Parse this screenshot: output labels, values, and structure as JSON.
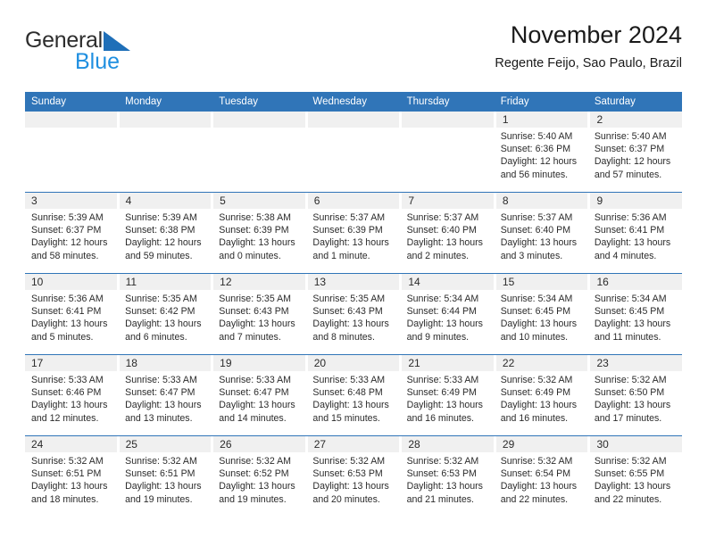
{
  "brand": {
    "word_general": "General",
    "word_blue": "Blue",
    "triangle_color": "#1f6fb8",
    "blue_text_color": "#1f8fe0"
  },
  "header": {
    "title": "November 2024",
    "subtitle": "Regente Feijo, Sao Paulo, Brazil"
  },
  "colors": {
    "header_blue": "#3075b8",
    "day_band_gray": "#f0f0f0",
    "text": "#2b2b2b"
  },
  "weekday_headers": [
    "Sunday",
    "Monday",
    "Tuesday",
    "Wednesday",
    "Thursday",
    "Friday",
    "Saturday"
  ],
  "weeks": [
    [
      {
        "day": "",
        "lines": []
      },
      {
        "day": "",
        "lines": []
      },
      {
        "day": "",
        "lines": []
      },
      {
        "day": "",
        "lines": []
      },
      {
        "day": "",
        "lines": []
      },
      {
        "day": "1",
        "lines": [
          "Sunrise: 5:40 AM",
          "Sunset: 6:36 PM",
          "Daylight: 12 hours",
          "and 56 minutes."
        ]
      },
      {
        "day": "2",
        "lines": [
          "Sunrise: 5:40 AM",
          "Sunset: 6:37 PM",
          "Daylight: 12 hours",
          "and 57 minutes."
        ]
      }
    ],
    [
      {
        "day": "3",
        "lines": [
          "Sunrise: 5:39 AM",
          "Sunset: 6:37 PM",
          "Daylight: 12 hours",
          "and 58 minutes."
        ]
      },
      {
        "day": "4",
        "lines": [
          "Sunrise: 5:39 AM",
          "Sunset: 6:38 PM",
          "Daylight: 12 hours",
          "and 59 minutes."
        ]
      },
      {
        "day": "5",
        "lines": [
          "Sunrise: 5:38 AM",
          "Sunset: 6:39 PM",
          "Daylight: 13 hours",
          "and 0 minutes."
        ]
      },
      {
        "day": "6",
        "lines": [
          "Sunrise: 5:37 AM",
          "Sunset: 6:39 PM",
          "Daylight: 13 hours",
          "and 1 minute."
        ]
      },
      {
        "day": "7",
        "lines": [
          "Sunrise: 5:37 AM",
          "Sunset: 6:40 PM",
          "Daylight: 13 hours",
          "and 2 minutes."
        ]
      },
      {
        "day": "8",
        "lines": [
          "Sunrise: 5:37 AM",
          "Sunset: 6:40 PM",
          "Daylight: 13 hours",
          "and 3 minutes."
        ]
      },
      {
        "day": "9",
        "lines": [
          "Sunrise: 5:36 AM",
          "Sunset: 6:41 PM",
          "Daylight: 13 hours",
          "and 4 minutes."
        ]
      }
    ],
    [
      {
        "day": "10",
        "lines": [
          "Sunrise: 5:36 AM",
          "Sunset: 6:41 PM",
          "Daylight: 13 hours",
          "and 5 minutes."
        ]
      },
      {
        "day": "11",
        "lines": [
          "Sunrise: 5:35 AM",
          "Sunset: 6:42 PM",
          "Daylight: 13 hours",
          "and 6 minutes."
        ]
      },
      {
        "day": "12",
        "lines": [
          "Sunrise: 5:35 AM",
          "Sunset: 6:43 PM",
          "Daylight: 13 hours",
          "and 7 minutes."
        ]
      },
      {
        "day": "13",
        "lines": [
          "Sunrise: 5:35 AM",
          "Sunset: 6:43 PM",
          "Daylight: 13 hours",
          "and 8 minutes."
        ]
      },
      {
        "day": "14",
        "lines": [
          "Sunrise: 5:34 AM",
          "Sunset: 6:44 PM",
          "Daylight: 13 hours",
          "and 9 minutes."
        ]
      },
      {
        "day": "15",
        "lines": [
          "Sunrise: 5:34 AM",
          "Sunset: 6:45 PM",
          "Daylight: 13 hours",
          "and 10 minutes."
        ]
      },
      {
        "day": "16",
        "lines": [
          "Sunrise: 5:34 AM",
          "Sunset: 6:45 PM",
          "Daylight: 13 hours",
          "and 11 minutes."
        ]
      }
    ],
    [
      {
        "day": "17",
        "lines": [
          "Sunrise: 5:33 AM",
          "Sunset: 6:46 PM",
          "Daylight: 13 hours",
          "and 12 minutes."
        ]
      },
      {
        "day": "18",
        "lines": [
          "Sunrise: 5:33 AM",
          "Sunset: 6:47 PM",
          "Daylight: 13 hours",
          "and 13 minutes."
        ]
      },
      {
        "day": "19",
        "lines": [
          "Sunrise: 5:33 AM",
          "Sunset: 6:47 PM",
          "Daylight: 13 hours",
          "and 14 minutes."
        ]
      },
      {
        "day": "20",
        "lines": [
          "Sunrise: 5:33 AM",
          "Sunset: 6:48 PM",
          "Daylight: 13 hours",
          "and 15 minutes."
        ]
      },
      {
        "day": "21",
        "lines": [
          "Sunrise: 5:33 AM",
          "Sunset: 6:49 PM",
          "Daylight: 13 hours",
          "and 16 minutes."
        ]
      },
      {
        "day": "22",
        "lines": [
          "Sunrise: 5:32 AM",
          "Sunset: 6:49 PM",
          "Daylight: 13 hours",
          "and 16 minutes."
        ]
      },
      {
        "day": "23",
        "lines": [
          "Sunrise: 5:32 AM",
          "Sunset: 6:50 PM",
          "Daylight: 13 hours",
          "and 17 minutes."
        ]
      }
    ],
    [
      {
        "day": "24",
        "lines": [
          "Sunrise: 5:32 AM",
          "Sunset: 6:51 PM",
          "Daylight: 13 hours",
          "and 18 minutes."
        ]
      },
      {
        "day": "25",
        "lines": [
          "Sunrise: 5:32 AM",
          "Sunset: 6:51 PM",
          "Daylight: 13 hours",
          "and 19 minutes."
        ]
      },
      {
        "day": "26",
        "lines": [
          "Sunrise: 5:32 AM",
          "Sunset: 6:52 PM",
          "Daylight: 13 hours",
          "and 19 minutes."
        ]
      },
      {
        "day": "27",
        "lines": [
          "Sunrise: 5:32 AM",
          "Sunset: 6:53 PM",
          "Daylight: 13 hours",
          "and 20 minutes."
        ]
      },
      {
        "day": "28",
        "lines": [
          "Sunrise: 5:32 AM",
          "Sunset: 6:53 PM",
          "Daylight: 13 hours",
          "and 21 minutes."
        ]
      },
      {
        "day": "29",
        "lines": [
          "Sunrise: 5:32 AM",
          "Sunset: 6:54 PM",
          "Daylight: 13 hours",
          "and 22 minutes."
        ]
      },
      {
        "day": "30",
        "lines": [
          "Sunrise: 5:32 AM",
          "Sunset: 6:55 PM",
          "Daylight: 13 hours",
          "and 22 minutes."
        ]
      }
    ]
  ]
}
